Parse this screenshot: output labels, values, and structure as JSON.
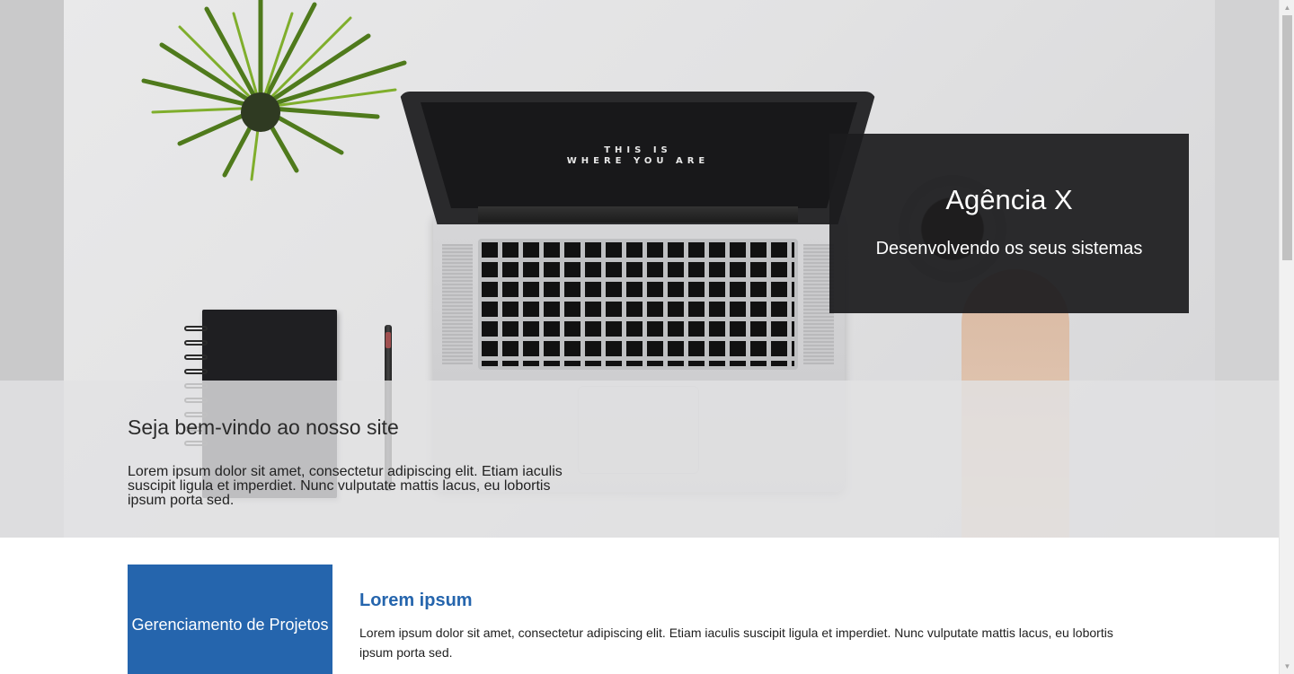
{
  "hero": {
    "screen_text_line1": "THIS IS",
    "screen_text_line2": "WHERE YOU ARE",
    "caption_title": "Agência X",
    "caption_subtitle": "Desenvolvendo os seus sistemas"
  },
  "welcome": {
    "title": "Seja bem-vindo ao nosso site",
    "text": "Lorem ipsum dolor sit amet, consectetur adipiscing elit. Etiam iaculis suscipit ligula et imperdiet. Nunc vulputate mattis lacus, eu lobortis ipsum porta sed."
  },
  "feature": {
    "box_label": "Gerenciamento de Projetos",
    "title": "Lorem ipsum",
    "text": "Lorem ipsum dolor sit amet, consectetur adipiscing elit. Etiam iaculis suscipit ligula et imperdiet. Nunc vulputate mattis lacus, eu lobortis ipsum porta sed."
  },
  "colors": {
    "accent_blue": "#2565ad",
    "caption_bg": "#1c1c1e"
  },
  "scrollbar": {
    "up_icon": "▲",
    "down_icon": "▼"
  }
}
